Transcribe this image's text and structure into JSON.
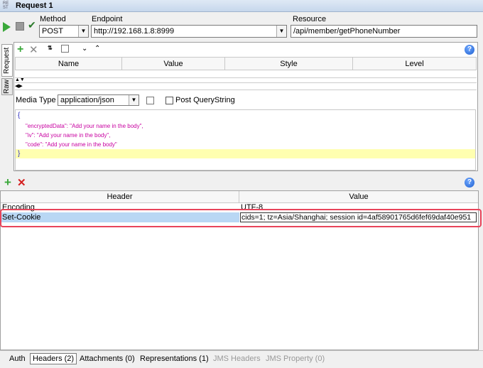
{
  "window": {
    "title": "Request 1",
    "icon_text": "RE ST"
  },
  "toolbar": {
    "method_label": "Method",
    "method_value": "POST",
    "endpoint_label": "Endpoint",
    "endpoint_value": "http://192.168.1.8:8999",
    "resource_label": "Resource",
    "resource_value": "/api/member/getPhoneNumber"
  },
  "side_tabs": {
    "request": "Request",
    "raw": "Raw"
  },
  "params_table": {
    "columns": [
      "Name",
      "Value",
      "Style",
      "Level"
    ]
  },
  "media": {
    "label": "Media Type",
    "value": "application/json",
    "post_qs_label": "Post QueryString"
  },
  "body_lines": [
    "{",
    "\"encryptedData\": \"Add your name in the body\",",
    "\"iv\": \"Add your name in the body\",",
    "\"code\": \"Add your name in the body\"",
    "}"
  ],
  "headers_table": {
    "columns": [
      "Header",
      "Value"
    ],
    "rows": [
      {
        "header": "Encoding",
        "value": "UTF-8"
      },
      {
        "header": "Set-Cookie",
        "value": "cids=1; tz=Asia/Shanghai; session id=4af58901765d6fef69daf40e951"
      }
    ]
  },
  "bottom_tabs": [
    {
      "label": "Auth",
      "active": false,
      "disabled": false
    },
    {
      "label": "Headers (2)",
      "active": true,
      "disabled": false
    },
    {
      "label": "Attachments (0)",
      "active": false,
      "disabled": false
    },
    {
      "label": "Representations (1)",
      "active": false,
      "disabled": false
    },
    {
      "label": "JMS Headers",
      "active": false,
      "disabled": true
    },
    {
      "label": "JMS Property (0)",
      "active": false,
      "disabled": true
    }
  ],
  "colors": {
    "accent_green": "#3aa83a",
    "remove_red": "#d42020",
    "selection_blue": "#b9d7f4",
    "highlight_border": "#e8445a",
    "editor_highlight": "#ffffb0"
  }
}
